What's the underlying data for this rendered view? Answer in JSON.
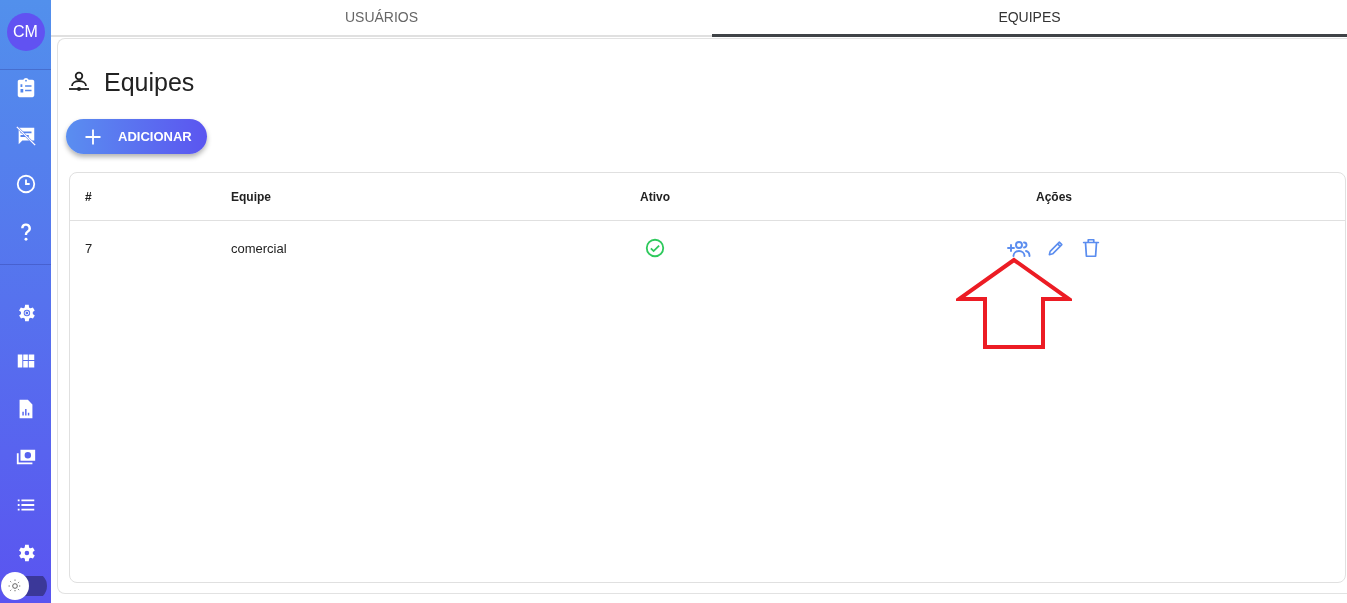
{
  "sidebar": {
    "avatar": "CM",
    "theme_toggle": {
      "on": false
    }
  },
  "tabs": [
    {
      "label": "USUÁRIOS",
      "selected": false
    },
    {
      "label": "EQUIPES",
      "selected": true
    }
  ],
  "page_title": "Equipes",
  "add_button": "ADICIONAR",
  "table": {
    "columns": [
      "#",
      "Equipe",
      "Ativo",
      "Ações"
    ],
    "rows": [
      {
        "id": "7",
        "name": "comercial",
        "active": true
      }
    ]
  }
}
